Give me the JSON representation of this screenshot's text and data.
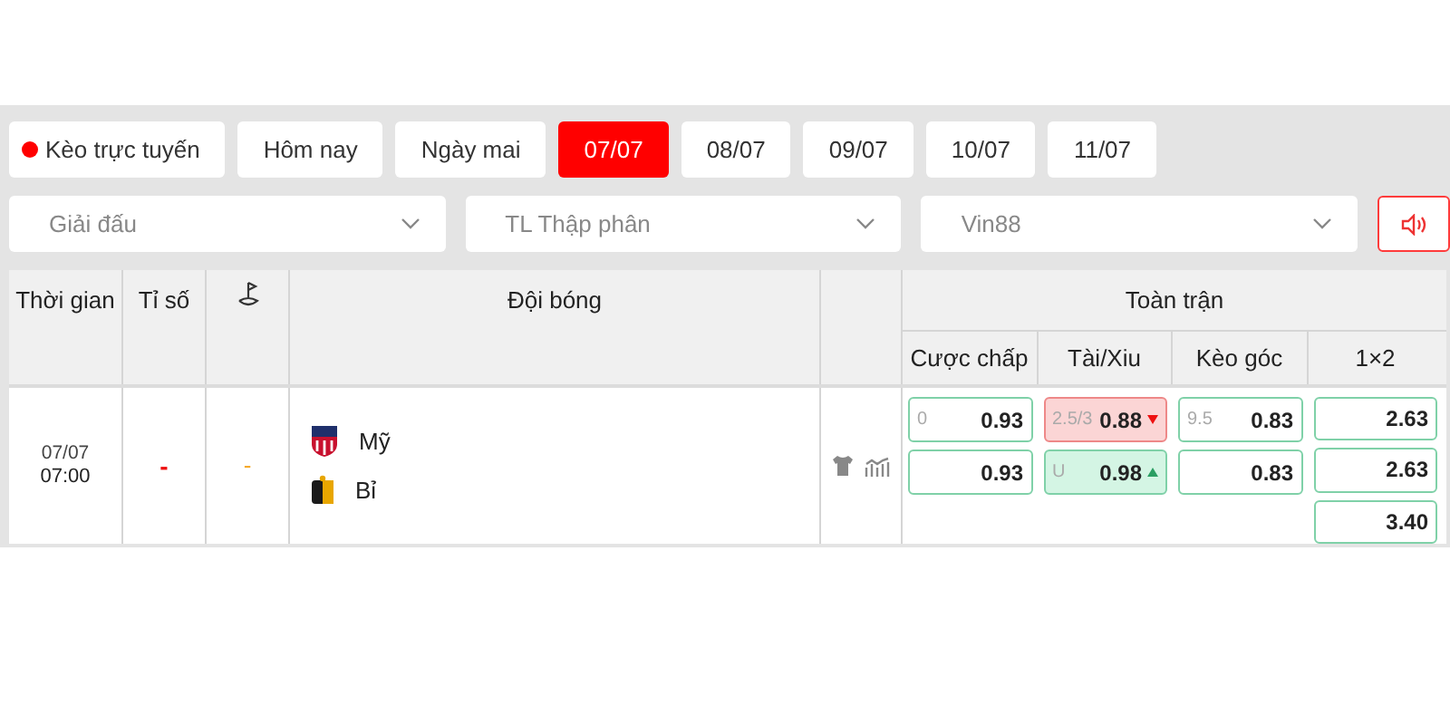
{
  "date_tabs": [
    {
      "label": "Kèo trực tuyến",
      "live": true,
      "selected": false
    },
    {
      "label": "Hôm nay",
      "live": false,
      "selected": false
    },
    {
      "label": "Ngày mai",
      "live": false,
      "selected": false
    },
    {
      "label": "07/07",
      "live": false,
      "selected": true
    },
    {
      "label": "08/07",
      "live": false,
      "selected": false
    },
    {
      "label": "09/07",
      "live": false,
      "selected": false
    },
    {
      "label": "10/07",
      "live": false,
      "selected": false
    },
    {
      "label": "11/07",
      "live": false,
      "selected": false
    }
  ],
  "filters": [
    {
      "value": "Giải đấu"
    },
    {
      "value": "TL Thập phân"
    },
    {
      "value": "Vin88"
    }
  ],
  "table": {
    "columns": [
      "Thời gian",
      "Tỉ số",
      "Đội bóng"
    ],
    "group": "Toàn trận",
    "odds_columns": [
      "Cược chấp",
      "Tài/Xiu",
      "Kèo góc",
      "1×2"
    ],
    "rows": [
      {
        "date": "07/07",
        "time": "07:00",
        "score": "-",
        "corner": "-",
        "teams": [
          "Mỹ",
          "Bỉ"
        ],
        "odds": [
          [
            {
              "line": "0",
              "value": "0.93",
              "kind": "plain"
            },
            {
              "value": "0.93",
              "kind": "plain"
            }
          ],
          [
            {
              "line": "2.5/3",
              "value": "0.88",
              "kind": "down"
            },
            {
              "line": "U",
              "value": "0.98",
              "kind": "up"
            }
          ],
          [
            {
              "line": "9.5",
              "value": "0.83",
              "kind": "plain"
            },
            {
              "value": "0.83",
              "kind": "plain"
            }
          ],
          [
            {
              "value": "2.63",
              "kind": "plain"
            },
            {
              "value": "2.63",
              "kind": "plain"
            },
            {
              "value": "3.40",
              "kind": "plain"
            }
          ]
        ]
      }
    ]
  }
}
